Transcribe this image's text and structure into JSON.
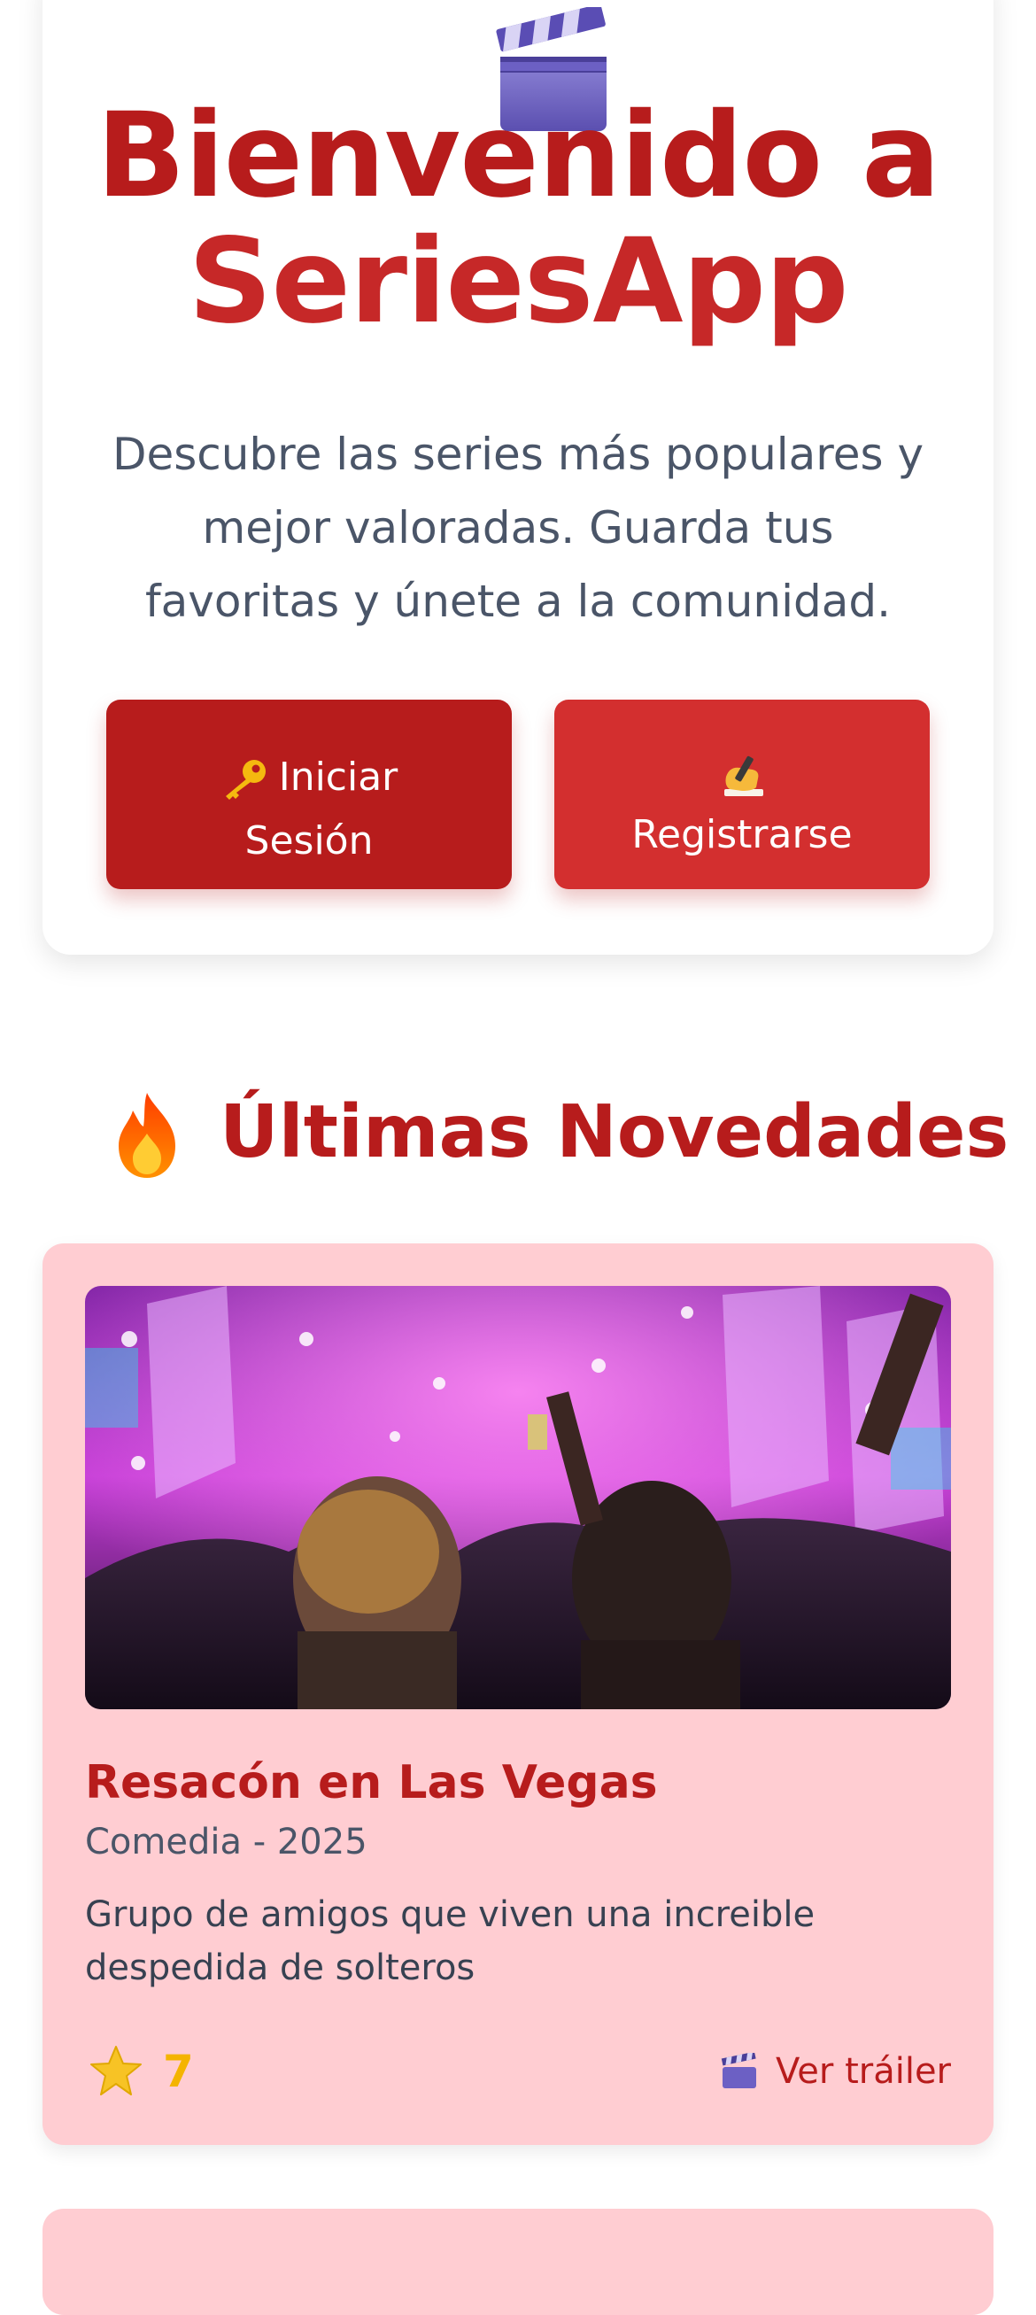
{
  "hero": {
    "icon": "clapperboard-icon",
    "title_line1": "Bienvenido a",
    "title_line2": "SeriesApp",
    "description": "Descubre las series más populares y mejor valoradas. Guarda tus favoritas y únete a la comunidad.",
    "login_button": {
      "icon": "key-icon",
      "label": "Iniciar Sesión"
    },
    "register_button": {
      "icon": "writing-hand-icon",
      "label": "Registrarse"
    }
  },
  "latest": {
    "icon": "fire-icon",
    "title": "Últimas Novedades",
    "series": [
      {
        "title": "Resacón en Las Vegas",
        "meta": "Comedia - 2025",
        "description": "Grupo de amigos que viven una increible despedida de solteros",
        "rating_icon": "star-icon",
        "rating": "7",
        "trailer_icon": "clapperboard-icon",
        "trailer_label": "Ver tráiler"
      }
    ]
  },
  "colors": {
    "primary": "#b71c1c",
    "secondary": "#d32f2f",
    "card_bg": "#ffcdd2",
    "text_muted": "#4a5568",
    "rating": "#f4b400"
  }
}
